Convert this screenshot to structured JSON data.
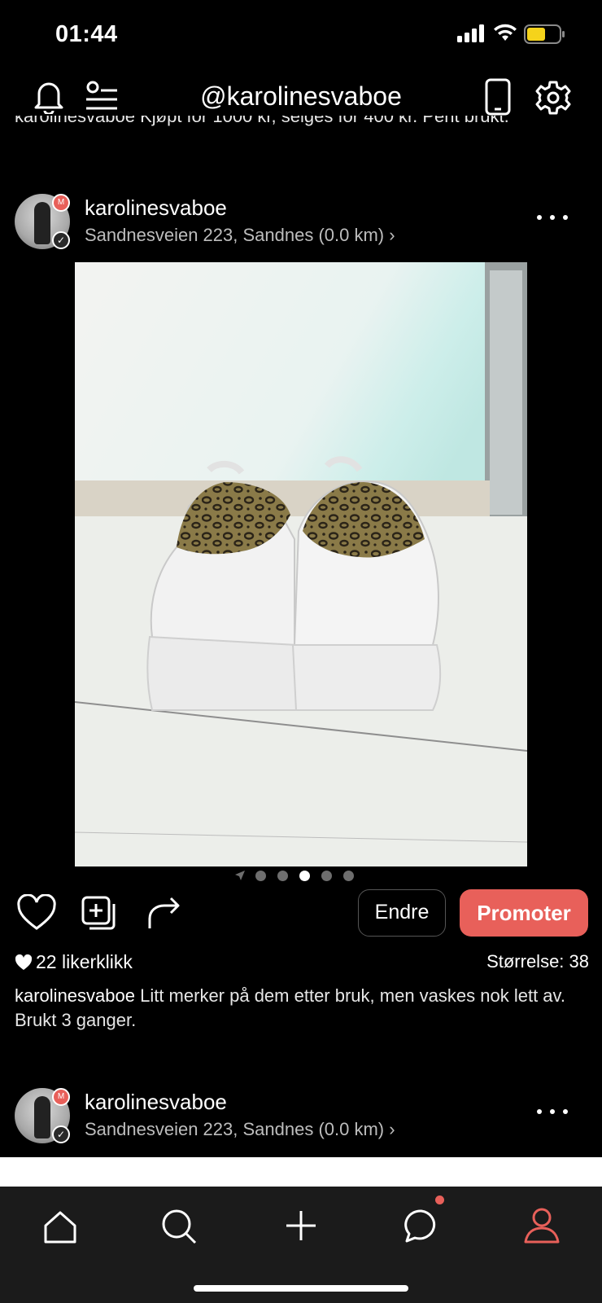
{
  "status_bar": {
    "time": "01:44",
    "icons": [
      "signal-icon",
      "wifi-icon",
      "battery-icon"
    ],
    "battery_color": "#f5d31b"
  },
  "header": {
    "title": "@karolinesvaboe",
    "left_icons": [
      "bell-icon",
      "user-list-icon"
    ],
    "right_icons": [
      "phone-icon",
      "gear-icon"
    ]
  },
  "previous_post_caption_fragment": "karolinesvaboe Kjøpt for 1000 kr, selges for 400 kr. Pent brukt.",
  "post": {
    "username": "karolinesvaboe",
    "location": "Sandnesveien 223, Sandnes (0.0 km) ›",
    "avatar_badge": "M",
    "photo_description_icon": "sneakers-photo",
    "pager": {
      "count": 5,
      "active_index": 2
    },
    "actions": {
      "like_icon": "heart-icon",
      "save_icon": "add-to-collection-icon",
      "share_icon": "share-arrow-icon",
      "edit_label": "Endre",
      "promote_label": "Promoter"
    },
    "likes_text": "22 likerklikk",
    "size_text": "Størrelse: 38",
    "caption_user": "karolinesvaboe",
    "caption_text": " Litt merker på dem etter bruk, men vaskes nok lett av. Brukt 3 ganger."
  },
  "next_post": {
    "username": "karolinesvaboe",
    "location": "Sandnesveien 223, Sandnes (0.0 km) ›",
    "avatar_badge": "M"
  },
  "tab_bar": {
    "tabs": [
      "home-icon",
      "search-icon",
      "plus-icon",
      "chat-icon",
      "profile-icon"
    ],
    "active_tab": "profile-icon",
    "accent_color": "#e8605a"
  }
}
